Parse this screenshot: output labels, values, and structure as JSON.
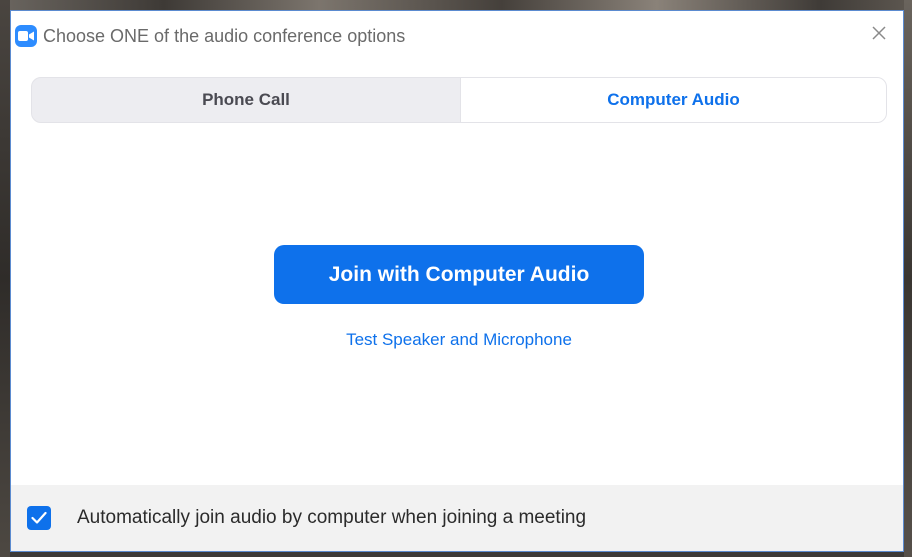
{
  "window": {
    "title": "Choose ONE of the audio conference options",
    "app_icon": "zoom-camera-icon",
    "close_icon": "close-icon"
  },
  "tabs": [
    {
      "label": "Phone Call",
      "selected": false
    },
    {
      "label": "Computer Audio",
      "selected": true
    }
  ],
  "main": {
    "join_button_label": "Join with Computer Audio",
    "test_link_label": "Test Speaker and Microphone"
  },
  "footer": {
    "checkbox_checked": true,
    "checkbox_label": "Automatically join audio by computer when joining a meeting"
  },
  "colors": {
    "accent": "#0e71eb",
    "app_icon": "#2d8cff",
    "tab_bar_bg": "#ededf1",
    "footer_bg": "#f2f2f2"
  }
}
